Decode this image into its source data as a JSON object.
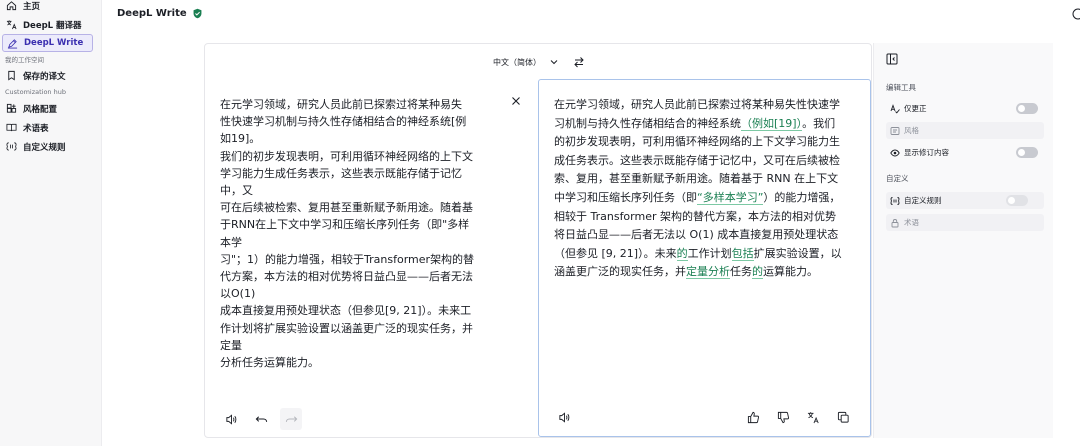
{
  "sidebar": {
    "items": [
      {
        "label": "主页",
        "icon": "home-icon"
      },
      {
        "label": "DeepL 翻译器",
        "icon": "translate-icon"
      },
      {
        "label": "DeepL Write",
        "icon": "write-icon",
        "active": true
      }
    ],
    "workspace_label": "我的工作空间",
    "workspace_items": [
      {
        "label": "保存的译文",
        "icon": "bookmark-icon"
      }
    ],
    "hub_label": "Customization hub",
    "hub_items": [
      {
        "label": "风格配置",
        "icon": "style-icon"
      },
      {
        "label": "术语表",
        "icon": "glossary-icon"
      },
      {
        "label": "自定义规则",
        "icon": "rules-icon"
      }
    ]
  },
  "header": {
    "title": "DeepL Write"
  },
  "editor": {
    "language": "中文（简体）",
    "source_text": "在元学习领域，研究人员此前已探索过将某种易失\n性快速学习机制与持久性存储相结合的神经系统[例\n如19]。\n我们的初步发现表明，可利用循环神经网络的上下文\n学习能力生成任务表示，这些表示既能存储于记忆\n中，又\n可在后续被检索、复用甚至重新赋予新用途。随着基\n于RNN在上下文中学习和压缩长序列任务（即\"多样\n本学\n习\"；1）的能力增强，相较于Transformer架构的替\n代方案，本方法的相对优势将日益凸显——后者无法\n以O(1)\n成本直接复用预处理状态（但参见[9, 21]）。未来工\n作计划将扩展实验设置以涵盖更广泛的现实任务，并\n定量\n分析任务运算能力。",
    "target_segments": [
      {
        "t": "在元学习领域，研究人员此前已探索过将某种易失性快速学习机制与持久性存储相结合的神经系统"
      },
      {
        "t": "（例如[19]）",
        "ins": true
      },
      {
        "t": "。我们的初步发现表明，可利用循环神经网络的上下文学习能力生成任务表示。"
      },
      {
        "t": "这些表示既能存储于记忆中，又可在后续被检索、复用，甚至重新赋予新用途。随着基于 RNN 在上下文中学习和压缩长序列任务（即"
      },
      {
        "t": "“多样本学习”",
        "ins": true
      },
      {
        "t": "）的能力增强，相较于 Transformer 架构的替代方案，本方法的相对优势将日益凸显——后者无法以 O(1) 成本直接复用预处理状态（但参见 [9, 21]）。未来"
      },
      {
        "t": "的",
        "ins": true
      },
      {
        "t": "工作计划"
      },
      {
        "t": "包括",
        "ins": true
      },
      {
        "t": "扩展实验设置，以涵盖更广泛的现实任务，并"
      },
      {
        "t": "定量分析",
        "ins": true
      },
      {
        "t": "任务"
      },
      {
        "t": "的",
        "ins": true
      },
      {
        "t": "运算能力。"
      }
    ]
  },
  "right_panel": {
    "edit_tools_label": "编辑工具",
    "correct_only": "仅更正",
    "style": "风格",
    "show_changes": "显示修订内容",
    "custom_label": "自定义",
    "custom_rules": "自定义规则",
    "glossary": "术语"
  },
  "colors": {
    "accent": "#3b2fb0",
    "insert": "#1a7f52",
    "brand_shield": "#1a7f52"
  }
}
